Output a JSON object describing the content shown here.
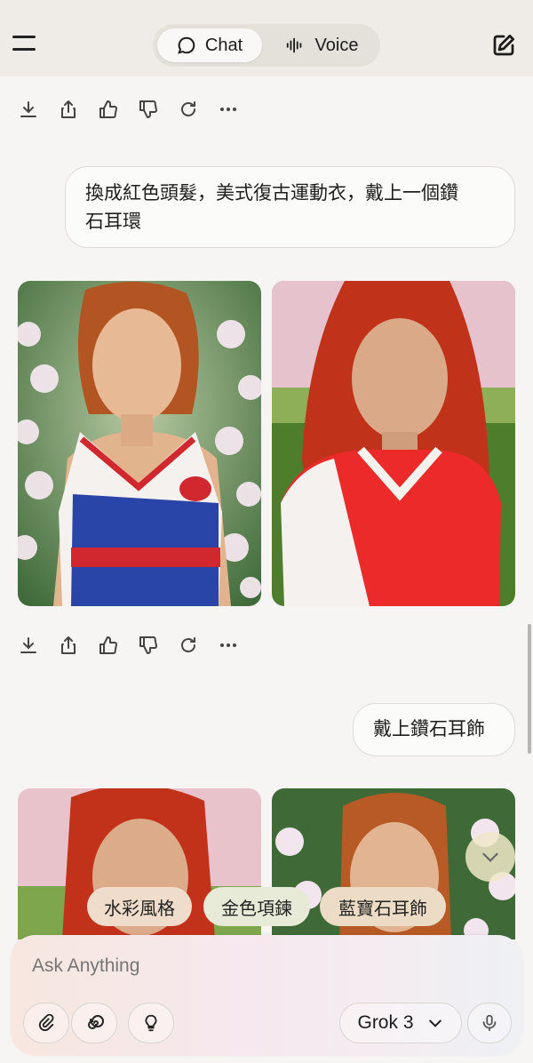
{
  "header": {
    "tabs": [
      {
        "label": "Chat",
        "icon": "chat-bubble-icon",
        "selected": true
      },
      {
        "label": "Voice",
        "icon": "waveform-icon",
        "selected": false
      }
    ]
  },
  "messages": [
    {
      "role": "user",
      "text_line1": "換成紅色頭髮，美式復古運動衣，戴上一個鑽",
      "text_line2": "石耳環"
    },
    {
      "role": "user",
      "text": "戴上鑽石耳飾"
    }
  ],
  "suggestions": [
    "水彩風格",
    "金色項鍊",
    "藍寶石耳飾"
  ],
  "composer": {
    "placeholder": "Ask Anything",
    "model": "Grok 3"
  },
  "colors": {
    "header_bg": "#efece7",
    "page_bg": "#f6f5f3",
    "chip_bg": "#efdccb",
    "chip_alt_bg": "#e8ead8",
    "scroll_btn_bg": "#f0e8c8"
  }
}
